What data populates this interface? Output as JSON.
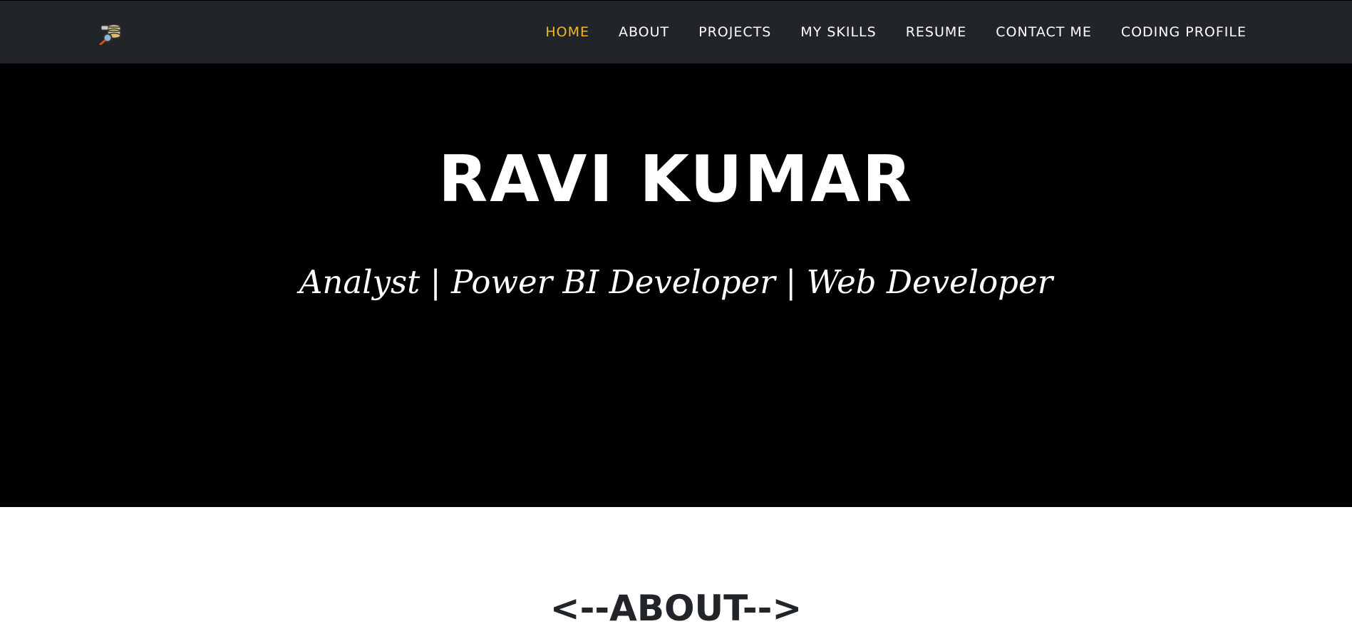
{
  "header": {
    "logo_icon": "data-analysis-logo-icon",
    "nav": [
      {
        "label": "HOME",
        "active": true
      },
      {
        "label": "ABOUT",
        "active": false
      },
      {
        "label": "PROJECTS",
        "active": false
      },
      {
        "label": "MY SKILLS",
        "active": false
      },
      {
        "label": "RESUME",
        "active": false
      },
      {
        "label": "CONTACT ME",
        "active": false
      },
      {
        "label": "CODING PROFILE",
        "active": false
      }
    ]
  },
  "hero": {
    "name": "RAVI KUMAR",
    "subtitle": "Analyst | Power BI Developer | Web Developer"
  },
  "about": {
    "heading": "<--ABOUT-->"
  },
  "colors": {
    "navbar_bg": "#212529",
    "active_link": "#f4b81a",
    "hero_bg": "#000000",
    "heading_text": "#212529"
  }
}
